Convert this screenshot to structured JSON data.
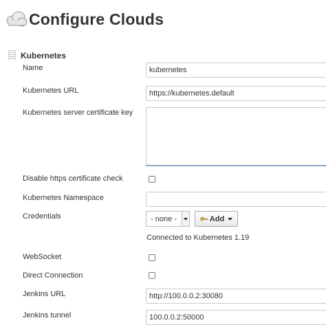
{
  "page": {
    "title": "Configure Clouds"
  },
  "section": {
    "title": "Kubernetes"
  },
  "fields": {
    "name": {
      "label": "Name",
      "value": "kubernetes"
    },
    "url": {
      "label": "Kubernetes URL",
      "value": "https://kubernetes.default"
    },
    "cert_key": {
      "label": "Kubernetes server certificate key",
      "value": ""
    },
    "disable_https": {
      "label": "Disable https certificate check",
      "checked": false
    },
    "namespace": {
      "label": "Kubernetes Namespace",
      "value": ""
    },
    "credentials": {
      "label": "Credentials",
      "selected": "- none -",
      "add_label": "Add",
      "status": "Connected to Kubernetes 1.19"
    },
    "websocket": {
      "label": "WebSocket",
      "checked": false
    },
    "direct_connection": {
      "label": "Direct Connection",
      "checked": false
    },
    "jenkins_url": {
      "label": "Jenkins URL",
      "value": "http://100.0.0.2:30080"
    },
    "jenkins_tunnel": {
      "label": "Jenkins tunnel",
      "value": "100.0.0.2:50000"
    }
  },
  "icons": {
    "header": "cloud-icon",
    "add": "key-icon"
  }
}
